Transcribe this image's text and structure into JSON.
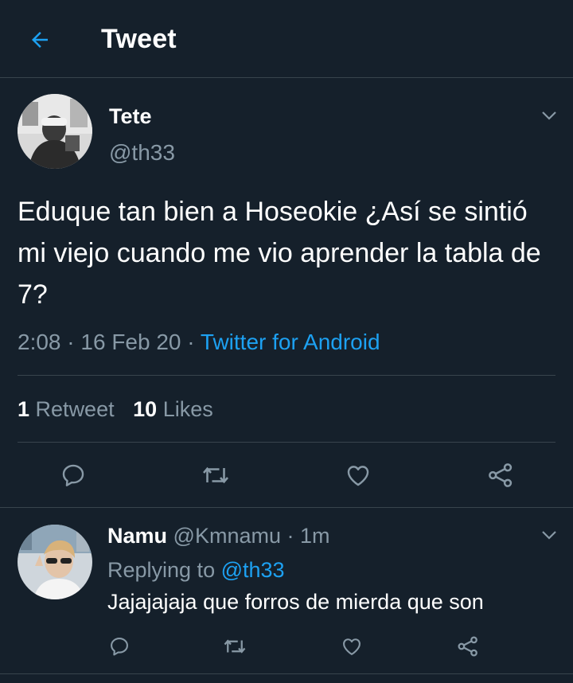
{
  "header": {
    "title": "Tweet",
    "back_icon": "arrow-left-icon",
    "accent": "#1da1f2"
  },
  "tweet": {
    "author_name": "Tete",
    "author_handle": "@th33",
    "text": "Eduque tan bien a Hoseokie ¿Así se sintió mi viejo cuando me vio aprender la tabla de 7?",
    "time": "2:08",
    "date": "16 Feb 20",
    "source": "Twitter for Android",
    "retweets_count": "1",
    "retweets_label": "Retweet",
    "likes_count": "10",
    "likes_label": "Likes"
  },
  "reply": {
    "author_name": "Namu",
    "author_handle": "@Kmnamu",
    "time_ago": "1m",
    "replying_label": "Replying to",
    "replying_to": "@th33",
    "text": "Jajajajaja que forros de mierda que son"
  },
  "colors": {
    "background": "#15202b",
    "divider": "#38444d",
    "secondary_text": "#8899a6",
    "link": "#1da1f2"
  }
}
